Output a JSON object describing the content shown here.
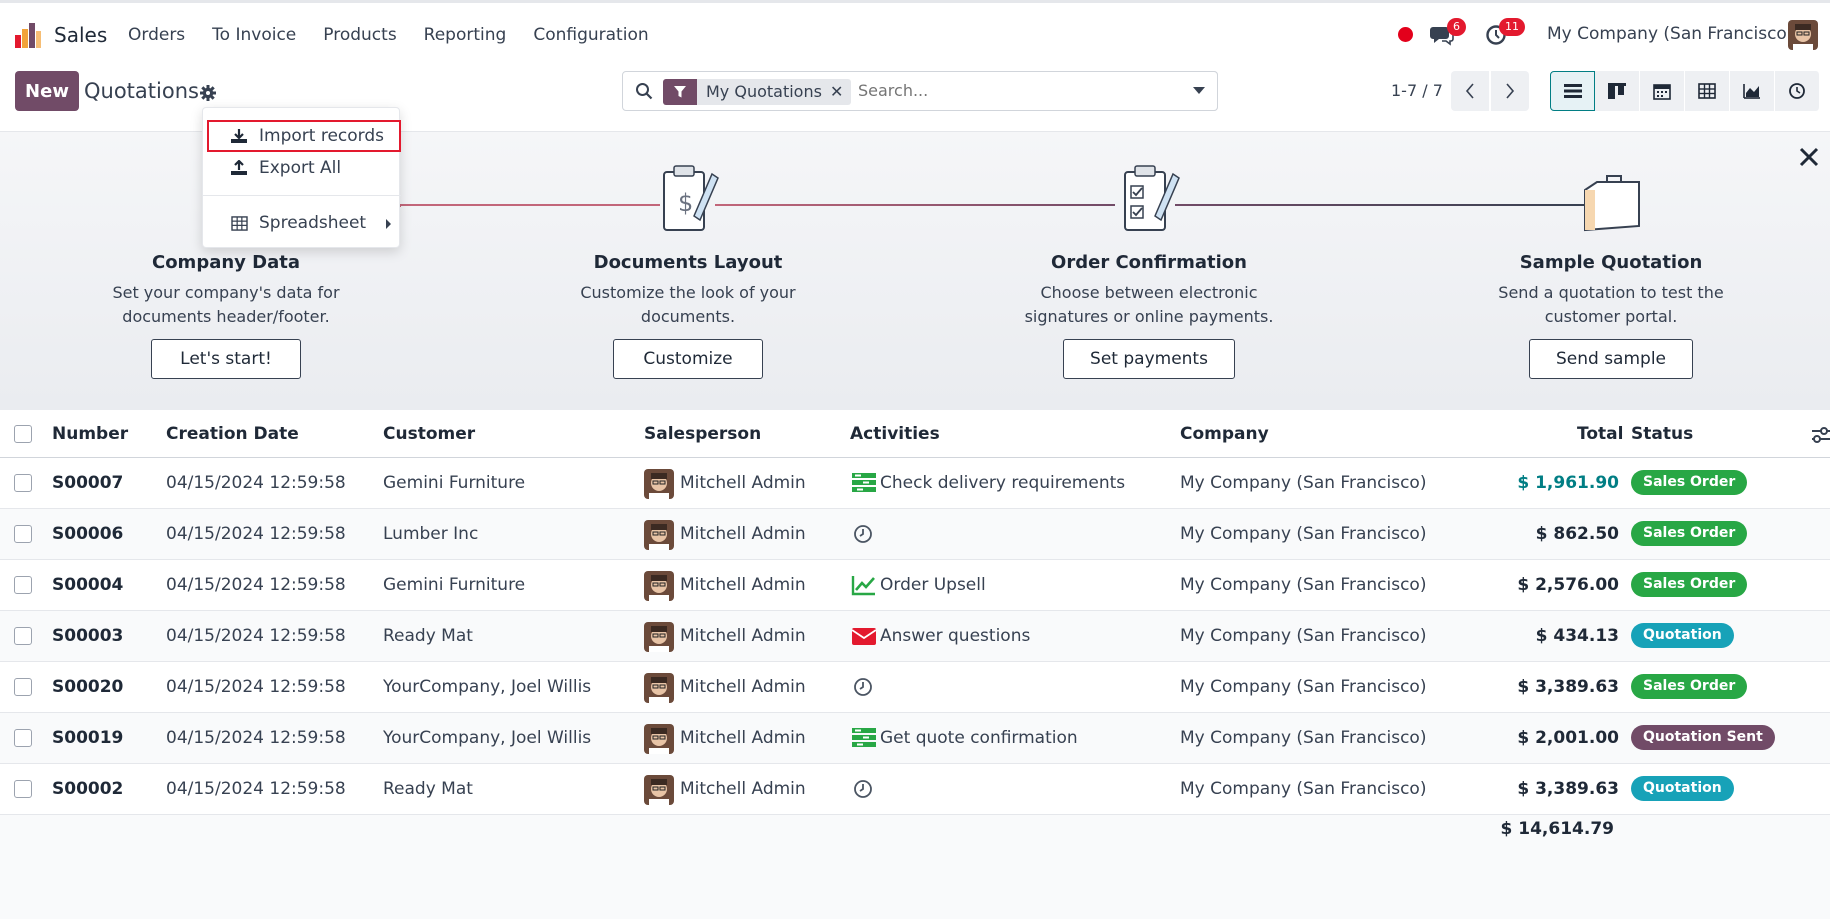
{
  "navbar": {
    "app_name": "Sales",
    "menu": [
      "Orders",
      "To Invoice",
      "Products",
      "Reporting",
      "Configuration"
    ],
    "chat_badge": "6",
    "activity_badge": "11",
    "company": "My Company (San Francisco)"
  },
  "control": {
    "new_label": "New",
    "title": "Quotations",
    "facet_label": "My Quotations",
    "search_placeholder": "Search...",
    "pager": "1-7 / 7"
  },
  "dropdown": {
    "import": "Import records",
    "export": "Export All",
    "spreadsheet": "Spreadsheet"
  },
  "banner": {
    "steps": [
      {
        "title": "Company Data",
        "desc": "Set your company's data for documents header/footer.",
        "button": "Let's start!"
      },
      {
        "title": "Documents Layout",
        "desc": "Customize the look of your documents.",
        "button": "Customize"
      },
      {
        "title": "Order Confirmation",
        "desc": "Choose between electronic signatures or online payments.",
        "button": "Set payments"
      },
      {
        "title": "Sample Quotation",
        "desc": "Send a quotation to test the customer portal.",
        "button": "Send sample"
      }
    ]
  },
  "table": {
    "headers": {
      "number": "Number",
      "date": "Creation Date",
      "customer": "Customer",
      "salesperson": "Salesperson",
      "activities": "Activities",
      "company": "Company",
      "total": "Total",
      "status": "Status"
    },
    "rows": [
      {
        "number": "S00007",
        "date": "04/15/2024 12:59:58",
        "customer": "Gemini Furniture",
        "salesperson": "Mitchell Admin",
        "activity": "Check delivery requirements",
        "activity_icon": "tasks-icon",
        "company": "My Company (San Francisco)",
        "total": "$ 1,961.90",
        "status": "Sales Order"
      },
      {
        "number": "S00006",
        "date": "04/15/2024 12:59:58",
        "customer": "Lumber Inc",
        "salesperson": "Mitchell Admin",
        "activity": "",
        "activity_icon": "clock-icon",
        "company": "My Company (San Francisco)",
        "total": "$ 862.50",
        "status": "Sales Order"
      },
      {
        "number": "S00004",
        "date": "04/15/2024 12:59:58",
        "customer": "Gemini Furniture",
        "salesperson": "Mitchell Admin",
        "activity": "Order Upsell",
        "activity_icon": "chart-line-icon",
        "company": "My Company (San Francisco)",
        "total": "$ 2,576.00",
        "status": "Sales Order"
      },
      {
        "number": "S00003",
        "date": "04/15/2024 12:59:58",
        "customer": "Ready Mat",
        "salesperson": "Mitchell Admin",
        "activity": "Answer questions",
        "activity_icon": "envelope-icon",
        "company": "My Company (San Francisco)",
        "total": "$ 434.13",
        "status": "Quotation"
      },
      {
        "number": "S00020",
        "date": "04/15/2024 12:59:58",
        "customer": "YourCompany, Joel Willis",
        "salesperson": "Mitchell Admin",
        "activity": "",
        "activity_icon": "clock-icon",
        "company": "My Company (San Francisco)",
        "total": "$ 3,389.63",
        "status": "Sales Order"
      },
      {
        "number": "S00019",
        "date": "04/15/2024 12:59:58",
        "customer": "YourCompany, Joel Willis",
        "salesperson": "Mitchell Admin",
        "activity": "Get quote confirmation",
        "activity_icon": "tasks-icon",
        "company": "My Company (San Francisco)",
        "total": "$ 2,001.00",
        "status": "Quotation Sent"
      },
      {
        "number": "S00002",
        "date": "04/15/2024 12:59:58",
        "customer": "Ready Mat",
        "salesperson": "Mitchell Admin",
        "activity": "",
        "activity_icon": "clock-icon",
        "company": "My Company (San Francisco)",
        "total": "$ 3,389.63",
        "status": "Quotation"
      }
    ],
    "grand_total": "$ 14,614.79"
  },
  "colors": {
    "brand": "#714b67",
    "accent_teal": "#017e84",
    "status_sales_order": "#28a745",
    "status_quotation": "#17a2b8",
    "status_quotation_sent": "#714b67",
    "activity_green": "#28a745",
    "activity_red": "#e3192e"
  }
}
